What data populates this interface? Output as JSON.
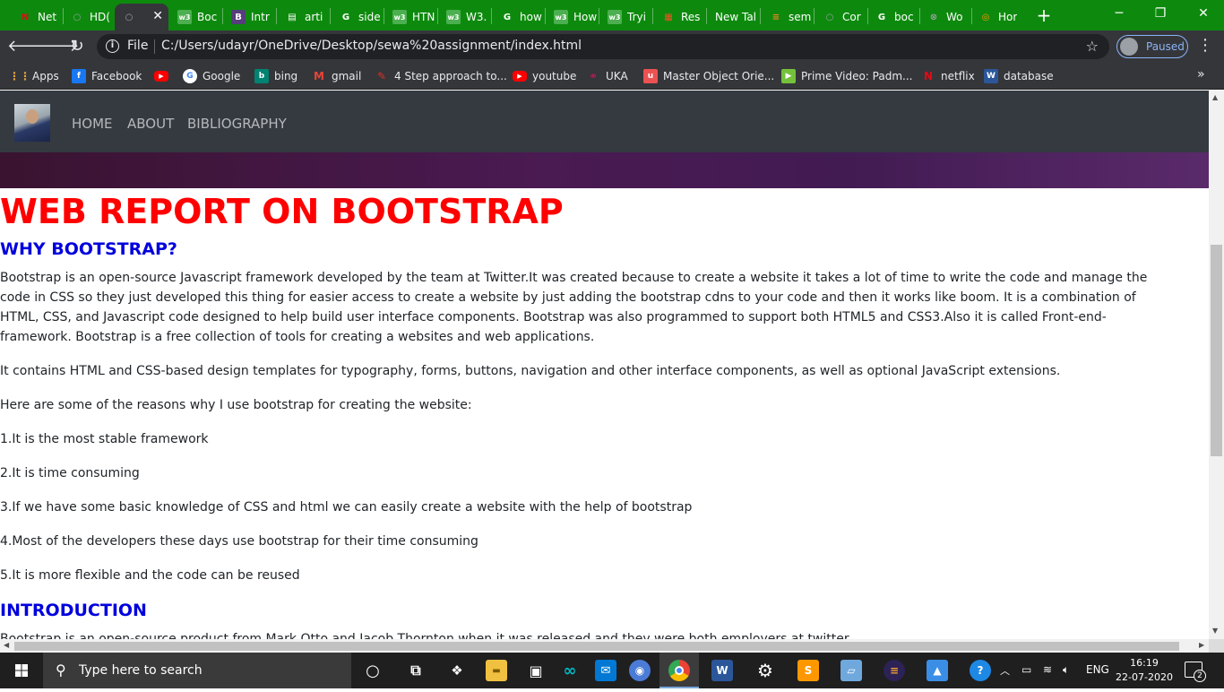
{
  "browser": {
    "tabs": [
      {
        "title": "Net",
        "icon": "netflix-icon",
        "color": "#e50914",
        "glyph": "N"
      },
      {
        "title": "HD(",
        "icon": "globe-icon",
        "color": "#9aa0a6",
        "glyph": "○"
      },
      {
        "title": "",
        "icon": "globe-icon",
        "color": "#9aa0a6",
        "glyph": "○",
        "active": true
      },
      {
        "title": "Boc",
        "icon": "w3schools-icon",
        "color": "#4caf50",
        "glyph": "w3"
      },
      {
        "title": "Intr",
        "icon": "bootstrap-icon",
        "color": "#563d7c",
        "glyph": "B"
      },
      {
        "title": "arti",
        "icon": "document-icon",
        "color": "#ffffff",
        "glyph": "▤"
      },
      {
        "title": "side",
        "icon": "google-icon",
        "color": "#ffffff",
        "glyph": "G"
      },
      {
        "title": "HTN",
        "icon": "w3schools-icon",
        "color": "#4caf50",
        "glyph": "w3"
      },
      {
        "title": "W3.",
        "icon": "w3schools-icon",
        "color": "#4caf50",
        "glyph": "w3"
      },
      {
        "title": "how",
        "icon": "google-icon",
        "color": "#ffffff",
        "glyph": "G"
      },
      {
        "title": "How",
        "icon": "w3schools-icon",
        "color": "#4caf50",
        "glyph": "w3"
      },
      {
        "title": "Tryi",
        "icon": "w3schools-icon",
        "color": "#4caf50",
        "glyph": "w3"
      },
      {
        "title": "Res",
        "icon": "microsoft-icon",
        "color": "#f25022",
        "glyph": "▦"
      },
      {
        "title": "New Tal",
        "icon": "",
        "color": "",
        "glyph": ""
      },
      {
        "title": "sem",
        "icon": "stackoverflow-icon",
        "color": "#f48024",
        "glyph": "≡"
      },
      {
        "title": "Cor",
        "icon": "globe-icon",
        "color": "#9aa0a6",
        "glyph": "○"
      },
      {
        "title": "boc",
        "icon": "google-icon",
        "color": "#ffffff",
        "glyph": "G"
      },
      {
        "title": "Wo",
        "icon": "wordpress-icon",
        "color": "#9aa0a6",
        "glyph": "⊗"
      },
      {
        "title": "Hor",
        "icon": "lifebuoy-icon",
        "color": "#ff9800",
        "glyph": "◎"
      }
    ],
    "window_controls": {
      "minimize": "─",
      "restore": "❐",
      "close": "✕"
    },
    "address": {
      "file_label": "File",
      "url": "C:/Users/udayr/OneDrive/Desktop/sewa%20assignment/index.html"
    },
    "profile_label": "Paused",
    "bookmarks": [
      {
        "label": "Apps",
        "icon": "apps-icon",
        "color": "#e8a33d",
        "glyph": "⋮⋮"
      },
      {
        "label": "Facebook",
        "icon": "facebook-icon",
        "color": "#1877f2",
        "glyph": "f"
      },
      {
        "label": "",
        "icon": "youtube-icon",
        "color": "#ff0000",
        "glyph": "▶"
      },
      {
        "label": "Google",
        "icon": "google-icon",
        "color": "#ffffff",
        "glyph": "G"
      },
      {
        "label": "bing",
        "icon": "bing-icon",
        "color": "#008373",
        "glyph": "b"
      },
      {
        "label": "gmail",
        "icon": "gmail-icon",
        "color": "#ea4335",
        "glyph": "M"
      },
      {
        "label": "4 Step approach to...",
        "icon": "pencil-icon",
        "color": "#d93025",
        "glyph": "✎"
      },
      {
        "label": "youtube",
        "icon": "youtube-icon",
        "color": "#ff0000",
        "glyph": "▶"
      },
      {
        "label": "UKA",
        "icon": "uka-icon",
        "color": "#c2185b",
        "glyph": "⚭"
      },
      {
        "label": "Master Object Orie...",
        "icon": "udemy-icon",
        "color": "#ec5252",
        "glyph": "u"
      },
      {
        "label": "Prime Video: Padm...",
        "icon": "prime-icon",
        "color": "#74c23b",
        "glyph": "▶"
      },
      {
        "label": "netflix",
        "icon": "netflix-icon",
        "color": "#e50914",
        "glyph": "N"
      },
      {
        "label": "database",
        "icon": "word-icon",
        "color": "#2b579a",
        "glyph": "W"
      }
    ]
  },
  "page": {
    "nav": [
      "HOME",
      "ABOUT",
      "BIBLIOGRAPHY"
    ],
    "title": "WEB REPORT ON BOOTSTRAP",
    "section1_heading": "WHY BOOTSTRAP?",
    "paragraphs": [
      "Bootstrap is an open-source Javascript framework developed by the team at Twitter.It was created because to create a website it takes a lot of time to write the code and manage the code in CSS so they just developed this thing for easier access to create a website by just adding the bootstrap cdns to your code and then it works like boom. It is a combination of HTML, CSS, and Javascript code designed to help build user interface components. Bootstrap was also programmed to support both HTML5 and CSS3.Also it is called Front-end-framework. Bootstrap is a free collection of tools for creating a websites and web applications.",
      "It contains HTML and CSS-based design templates for typography, forms, buttons, navigation and other interface components, as well as optional JavaScript extensions.",
      "Here are some of the reasons why I use bootstrap for creating the website:",
      "1.It is the most stable framework",
      "2.It is time consuming",
      "3.If we have some basic knowledge of CSS and html we can easily create a website with the help of bootstrap",
      "4.Most of the developers these days use bootstrap for their time consuming",
      "5.It is more flexible and the code can be reused"
    ],
    "section2_heading": "INTRODUCTION",
    "section2_text": "Bootstrap is an open-source product from Mark Otto and Jacob Thornton when it was released and they were both employers at twitter"
  },
  "taskbar": {
    "search_placeholder": "Type here to search",
    "language": "ENG",
    "time": "16:19",
    "date": "22-07-2020",
    "notification_count": "2"
  }
}
